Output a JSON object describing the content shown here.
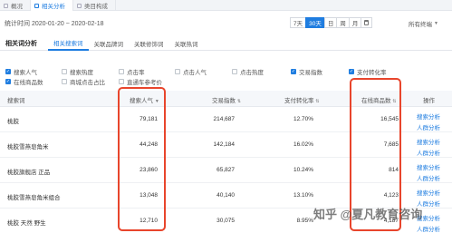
{
  "tabs": [
    {
      "label": "概况",
      "active": false
    },
    {
      "label": "相关分析",
      "active": true
    },
    {
      "label": "类目构成",
      "active": false
    }
  ],
  "date_range": "统计时间 2020-01-20 ~ 2020-02-18",
  "period_buttons": [
    "7天",
    "30天",
    "日",
    "周",
    "月"
  ],
  "period_selected": "30天",
  "terminal": "所有终端",
  "section_title": "相关词分析",
  "sub_tabs": [
    {
      "label": "相关搜索词",
      "active": true
    },
    {
      "label": "关联品牌词",
      "active": false
    },
    {
      "label": "关联修饰词",
      "active": false
    },
    {
      "label": "关联热词",
      "active": false
    }
  ],
  "metrics": [
    {
      "label": "搜索人气",
      "checked": true
    },
    {
      "label": "搜索热度",
      "checked": false
    },
    {
      "label": "点击率",
      "checked": false
    },
    {
      "label": "点击人气",
      "checked": false
    },
    {
      "label": "点击热度",
      "checked": false
    },
    {
      "label": "交易指数",
      "checked": true
    },
    {
      "label": "支付转化率",
      "checked": true
    },
    {
      "label": "在线商品数",
      "checked": true
    },
    {
      "label": "商城点击占比",
      "checked": false
    },
    {
      "label": "直通车参考价",
      "checked": false
    }
  ],
  "table": {
    "headers": [
      "搜索词",
      "搜索人气",
      "交易指数",
      "支付转化率",
      "在线商品数",
      "操作"
    ],
    "rows": [
      {
        "keyword": "桃胶",
        "popularity": "79,181",
        "trade_index": "214,687",
        "conversion": "12.70%",
        "products": "16,545"
      },
      {
        "keyword": "桃胶雪燕皂角米",
        "popularity": "44,248",
        "trade_index": "142,184",
        "conversion": "16.02%",
        "products": "7,685"
      },
      {
        "keyword": "桃胶旗舰店 正品",
        "popularity": "23,860",
        "trade_index": "65,827",
        "conversion": "10.24%",
        "products": "814"
      },
      {
        "keyword": "桃胶雪燕皂角米组合",
        "popularity": "13,048",
        "trade_index": "40,140",
        "conversion": "13.10%",
        "products": "4,123"
      },
      {
        "keyword": "桃胶 天然 野生",
        "popularity": "12,710",
        "trade_index": "30,075",
        "conversion": "8.95%",
        "products": "4,187"
      }
    ],
    "op_search_analysis": "搜索分析",
    "op_crowd_analysis": "人群分析"
  },
  "watermark": "知乎 @夏凡教育咨询",
  "accent_color": "#1f7de0",
  "highlight_color": "#e8452c"
}
